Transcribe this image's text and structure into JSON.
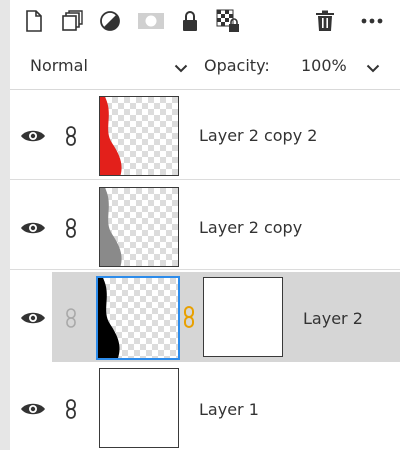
{
  "toolbar": {
    "icons": [
      "new-layer-icon",
      "group-layers-icon",
      "adjustment-layer-icon",
      "add-mask-icon",
      "lock-icon",
      "lock-transparency-icon",
      "delete-icon",
      "more-icon"
    ]
  },
  "blend": {
    "mode": "Normal",
    "opacity_label": "Opacity:",
    "opacity_value": "100%"
  },
  "colors": {
    "accent": "#2d8ceb",
    "selected_row": "#d6d6d6",
    "red_fill": "#e3201b",
    "gray_fill": "#8a8a8a",
    "black_fill": "#000000",
    "link_gold": "#e8a000"
  },
  "layers": [
    {
      "name": "Layer 2 copy 2",
      "visible": true,
      "selected": false,
      "fill": "red"
    },
    {
      "name": "Layer 2 copy",
      "visible": true,
      "selected": false,
      "fill": "gray"
    },
    {
      "name": "Layer 2",
      "visible": true,
      "selected": true,
      "fill": "black",
      "has_mask": true
    },
    {
      "name": "Layer 1",
      "visible": true,
      "selected": false,
      "fill": "white"
    }
  ]
}
